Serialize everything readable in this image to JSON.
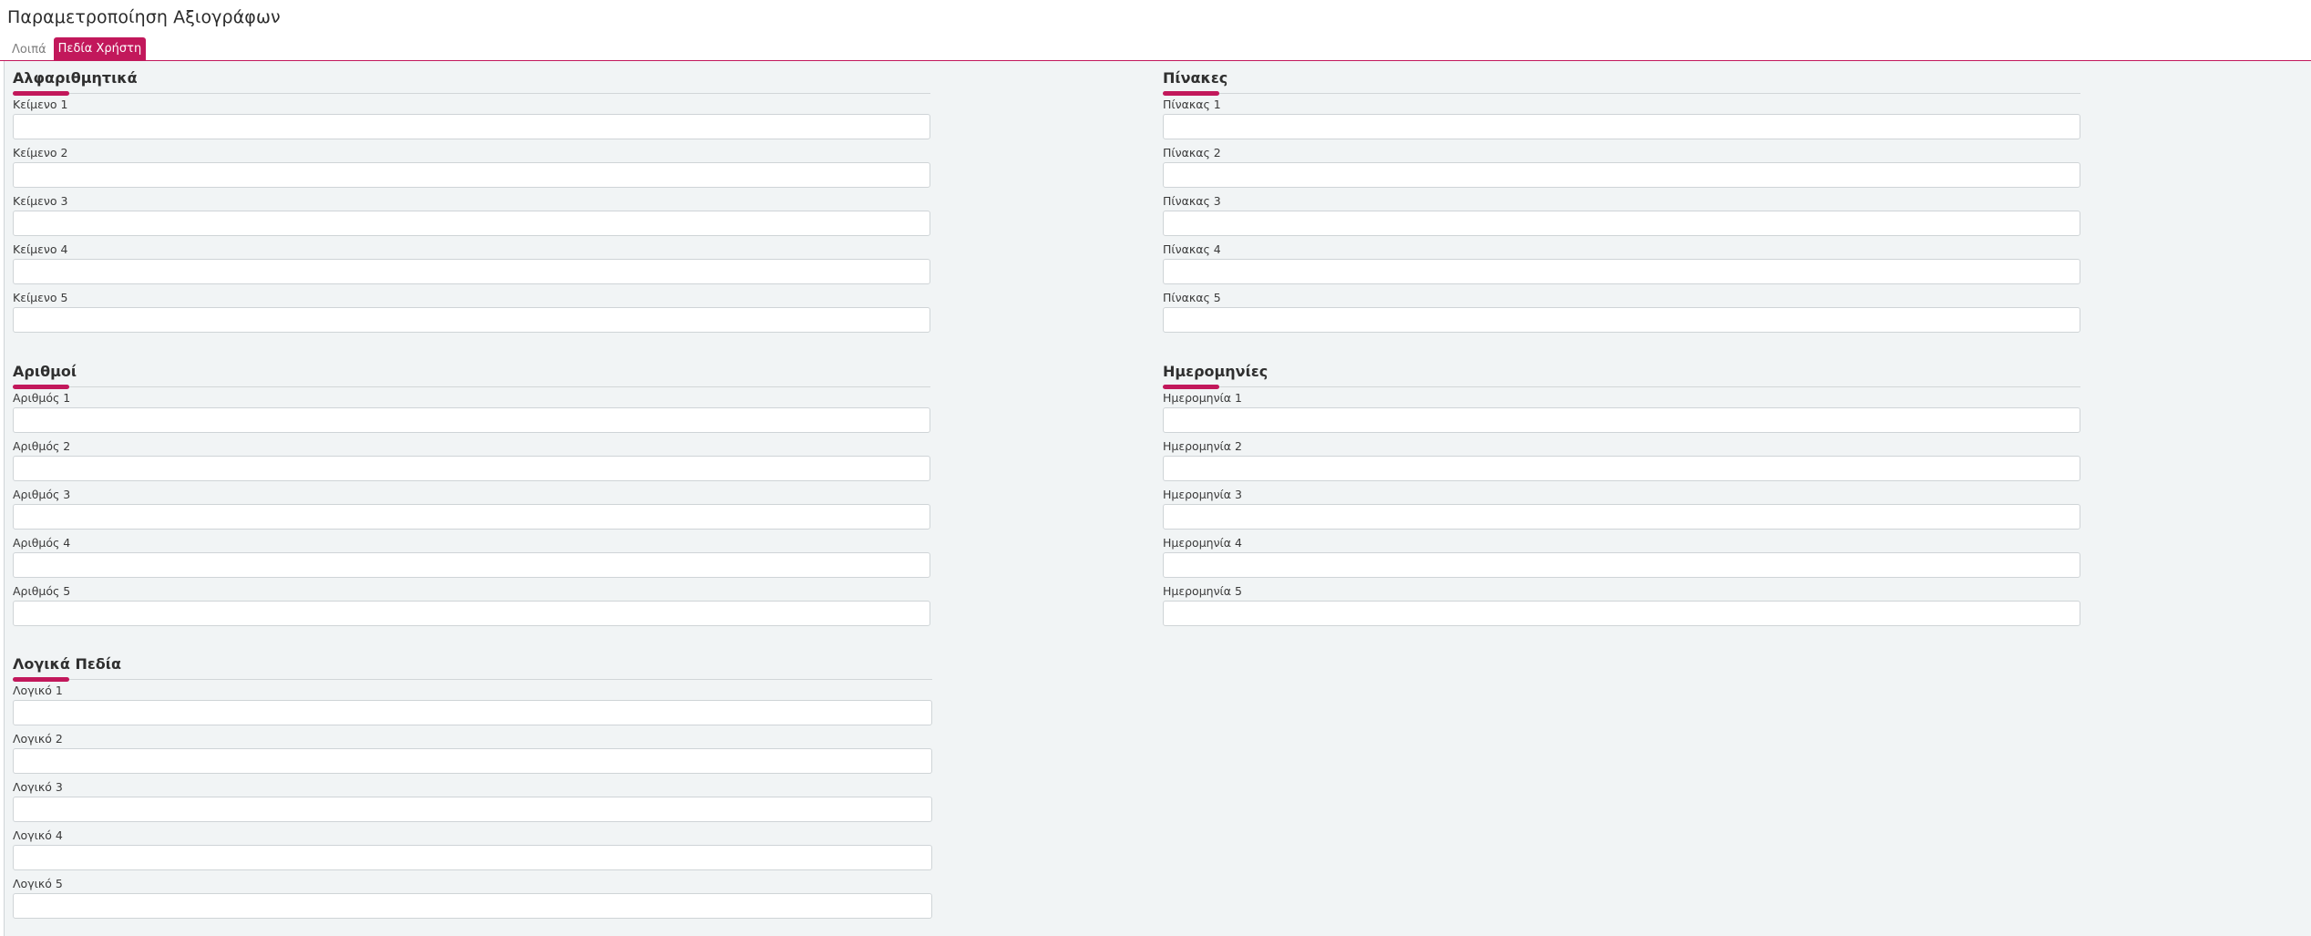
{
  "page": {
    "title": "Παραμετροποίηση Αξιογράφων"
  },
  "tabs": [
    {
      "label": "Λοιπά",
      "active": false
    },
    {
      "label": "Πεδία Χρήστη",
      "active": true
    }
  ],
  "colors": {
    "accent": "#c2185b",
    "background": "#f1f4f5"
  },
  "sections": {
    "alphanumeric": {
      "title": "Αλφαριθμητικά",
      "fields": [
        {
          "label": "Κείμενο 1",
          "value": ""
        },
        {
          "label": "Κείμενο 2",
          "value": ""
        },
        {
          "label": "Κείμενο 3",
          "value": ""
        },
        {
          "label": "Κείμενο 4",
          "value": ""
        },
        {
          "label": "Κείμενο 5",
          "value": ""
        }
      ]
    },
    "tables": {
      "title": "Πίνακες",
      "fields": [
        {
          "label": "Πίνακας 1",
          "value": ""
        },
        {
          "label": "Πίνακας 2",
          "value": ""
        },
        {
          "label": "Πίνακας 3",
          "value": ""
        },
        {
          "label": "Πίνακας 4",
          "value": ""
        },
        {
          "label": "Πίνακας 5",
          "value": ""
        }
      ]
    },
    "numbers": {
      "title": "Αριθμοί",
      "fields": [
        {
          "label": "Αριθμός 1",
          "value": ""
        },
        {
          "label": "Αριθμός 2",
          "value": ""
        },
        {
          "label": "Αριθμός 3",
          "value": ""
        },
        {
          "label": "Αριθμός 4",
          "value": ""
        },
        {
          "label": "Αριθμός 5",
          "value": ""
        }
      ]
    },
    "dates": {
      "title": "Ημερομηνίες",
      "fields": [
        {
          "label": "Ημερομηνία 1",
          "value": ""
        },
        {
          "label": "Ημερομηνία 2",
          "value": ""
        },
        {
          "label": "Ημερομηνία 3",
          "value": ""
        },
        {
          "label": "Ημερομηνία 4",
          "value": ""
        },
        {
          "label": "Ημερομηνία 5",
          "value": ""
        }
      ]
    },
    "logical": {
      "title": "Λογικά Πεδία",
      "fields": [
        {
          "label": "Λογικό 1",
          "value": ""
        },
        {
          "label": "Λογικό 2",
          "value": ""
        },
        {
          "label": "Λογικό 3",
          "value": ""
        },
        {
          "label": "Λογικό 4",
          "value": ""
        },
        {
          "label": "Λογικό 5",
          "value": ""
        }
      ]
    }
  }
}
